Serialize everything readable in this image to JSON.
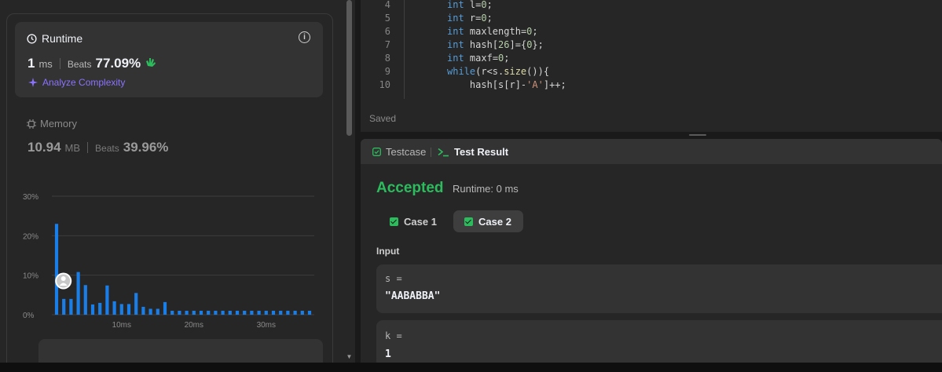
{
  "runtime": {
    "title": "Runtime",
    "value": "1",
    "unit": "ms",
    "beats_label": "Beats",
    "beats_value": "77.09%",
    "analyze_label": "Analyze Complexity"
  },
  "memory": {
    "title": "Memory",
    "value": "10.94",
    "unit": "MB",
    "beats_label": "Beats",
    "beats_value": "39.96%"
  },
  "chart_data": {
    "type": "bar",
    "y_ticks": [
      "30%",
      "20%",
      "10%",
      "0%"
    ],
    "x_ticks": [
      "10ms",
      "20ms",
      "30ms"
    ],
    "ylim": [
      0,
      30
    ],
    "x": [
      1,
      2,
      3,
      4,
      5,
      6,
      7,
      8,
      9,
      10,
      11,
      12,
      13,
      14,
      15,
      16,
      17,
      18,
      19,
      20,
      21,
      22,
      23,
      24,
      25,
      26,
      27,
      28,
      29,
      30,
      31,
      32,
      33,
      34,
      35,
      36
    ],
    "values": [
      23,
      4,
      4,
      10.8,
      7.5,
      2.6,
      3,
      7.4,
      3.4,
      2.7,
      2.7,
      5.5,
      2,
      1.5,
      1.5,
      3.2,
      1,
      1,
      1,
      1,
      1,
      1,
      1,
      1,
      1,
      1,
      1,
      1,
      1,
      1,
      1,
      1,
      1,
      1,
      1,
      1
    ],
    "highlight_x": 2,
    "colors": {
      "bar": "#1a7ee8",
      "grid": "#3d3d3d"
    }
  },
  "code": {
    "lines": [
      {
        "n": "4",
        "tokens": [
          [
            "kw",
            "int"
          ],
          [
            "",
            "l"
          ],
          [
            "",
            "="
          ],
          [
            "num",
            "0"
          ],
          [
            "",
            ";"
          ]
        ]
      },
      {
        "n": "5",
        "tokens": [
          [
            "kw",
            "int"
          ],
          [
            "",
            "r"
          ],
          [
            "",
            "="
          ],
          [
            "num",
            "0"
          ],
          [
            "",
            ";"
          ]
        ]
      },
      {
        "n": "6",
        "tokens": [
          [
            "kw",
            "int"
          ],
          [
            "",
            "maxlength"
          ],
          [
            "",
            "="
          ],
          [
            "num",
            "0"
          ],
          [
            "",
            ";"
          ]
        ]
      },
      {
        "n": "7",
        "tokens": [
          [
            "kw",
            "int"
          ],
          [
            "",
            "hash"
          ],
          [
            "",
            "["
          ],
          [
            "num",
            "26"
          ],
          [
            "",
            "]={"
          ],
          [
            "num",
            "0"
          ],
          [
            "",
            "};"
          ]
        ]
      },
      {
        "n": "8",
        "tokens": [
          [
            "kw",
            "int"
          ],
          [
            "",
            "maxf"
          ],
          [
            "",
            "="
          ],
          [
            "num",
            "0"
          ],
          [
            "",
            ";"
          ]
        ]
      },
      {
        "n": "9",
        "tokens": [
          [
            "kw",
            "while"
          ],
          [
            "",
            "(r<s."
          ],
          [
            "fn",
            "size"
          ],
          [
            "",
            "()){"
          ]
        ]
      },
      {
        "n": "10",
        "tokens": [
          [
            "",
            "    hash[s[r]-"
          ],
          [
            "str",
            "'A'"
          ],
          [
            "",
            "]++;"
          ]
        ]
      }
    ],
    "saved_label": "Saved"
  },
  "result": {
    "testcase_tab": "Testcase",
    "result_tab": "Test Result",
    "status": "Accepted",
    "runtime_label": "Runtime: 0 ms",
    "cases": [
      "Case 1",
      "Case 2"
    ],
    "input_label": "Input",
    "inputs": [
      {
        "name": "s =",
        "value": "\"AABABBA\""
      },
      {
        "name": "k =",
        "value": "1"
      }
    ]
  }
}
